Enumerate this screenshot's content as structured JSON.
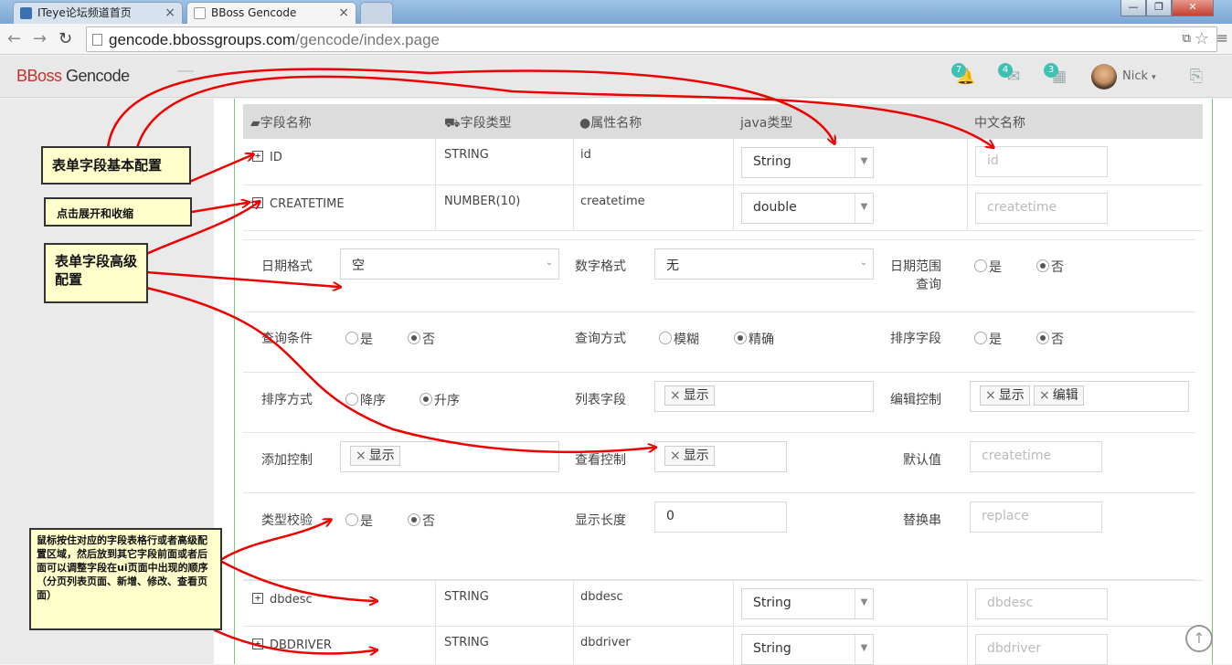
{
  "browser": {
    "tabs": [
      {
        "label": "ITeye论坛频道首页",
        "close": "×"
      },
      {
        "label": "BBoss Gencode",
        "close": "×"
      }
    ],
    "url_host": "gencode.bbossgroups.com",
    "url_path": "/gencode/index.page",
    "window_controls": [
      "—",
      "❐",
      "✕"
    ]
  },
  "app": {
    "brand_b": "BBoss",
    "brand_rest": " Gencode",
    "badges": {
      "notifications": "7",
      "messages": "4",
      "tasks": "3"
    },
    "user": "Nick"
  },
  "table": {
    "headers": [
      "字段名称",
      "字段类型",
      "属性名称",
      "java类型",
      "中文名称"
    ],
    "rows_top": [
      {
        "toggle": "+",
        "name": "ID",
        "type": "STRING",
        "prop": "id",
        "java": "String",
        "cn_placeholder": "id"
      },
      {
        "toggle": "−",
        "name": "CREATETIME",
        "type": "NUMBER(10)",
        "prop": "createtime",
        "java": "double",
        "cn_placeholder": "createtime"
      }
    ],
    "rows_bottom": [
      {
        "toggle": "+",
        "name": "dbdesc",
        "type": "STRING",
        "prop": "dbdesc",
        "java": "String",
        "cn_placeholder": "dbdesc"
      },
      {
        "toggle": "+",
        "name": "DBDRIVER",
        "type": "STRING",
        "prop": "dbdriver",
        "java": "String",
        "cn_placeholder": "dbdriver"
      }
    ]
  },
  "advanced": {
    "date_format_label": "日期格式",
    "date_format_value": "空",
    "number_format_label": "数字格式",
    "number_format_value": "无",
    "date_range_label_1": "日期范围",
    "date_range_label_2": "查询",
    "query_cond_label": "查询条件",
    "query_mode_label": "查询方式",
    "query_mode_fuzzy": "模糊",
    "query_mode_exact": "精确",
    "sort_field_label": "排序字段",
    "sort_order_label": "排序方式",
    "sort_desc": "降序",
    "sort_asc": "升序",
    "list_field_label": "列表字段",
    "edit_ctrl_label": "编辑控制",
    "add_ctrl_label": "添加控制",
    "view_ctrl_label": "查看控制",
    "default_label": "默认值",
    "default_placeholder": "createtime",
    "type_check_label": "类型校验",
    "display_len_label": "显示长度",
    "display_len_value": "0",
    "replace_label": "替换串",
    "replace_placeholder": "replace",
    "yes": "是",
    "no": "否",
    "tag_show": "显示",
    "tag_edit": "编辑",
    "tag_x": "×"
  },
  "notes": {
    "basic": "表单字段基本配置",
    "toggle": "点击展开和收缩",
    "advanced": "表单字段高级配置",
    "drag": "鼠标按住对应的字段表格行或者高级配置区域，然后放到其它字段前面或者后面可以调整字段在ui页面中出现的顺序（分页列表页面、新增、修改、查看页面）"
  }
}
